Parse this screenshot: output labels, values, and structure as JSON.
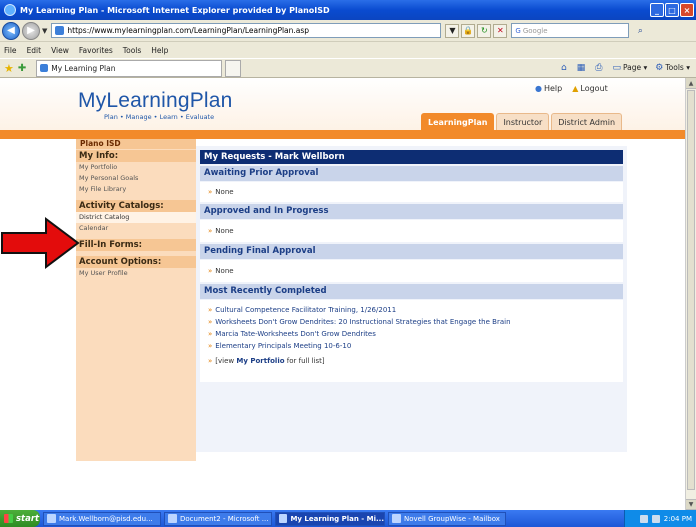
{
  "window": {
    "title": "My Learning Plan - Microsoft Internet Explorer provided by PlanoISD"
  },
  "address": {
    "url": "https://www.mylearningplan.com/LearningPlan/LearningPlan.asp",
    "search_placeholder": "Google"
  },
  "menu": [
    "File",
    "Edit",
    "View",
    "Favorites",
    "Tools",
    "Help"
  ],
  "favbar": {
    "tab_title": "My Learning Plan",
    "page_label": "Page",
    "tools_label": "Tools"
  },
  "site": {
    "logo": "MyLearningPlan",
    "tagline": "Plan • Manage • Learn • Evaluate",
    "help": "Help",
    "logout": "Logout",
    "tabs": [
      {
        "label": "LearningPlan",
        "active": true
      },
      {
        "label": "Instructor",
        "active": false
      },
      {
        "label": "District Admin",
        "active": false
      }
    ],
    "district": "Plano ISD"
  },
  "sidebar": {
    "my_info": {
      "heading": "My Info:",
      "items": [
        "My Portfolio",
        "My Personal Goals",
        "My File Library"
      ]
    },
    "catalogs": {
      "heading": "Activity Catalogs:",
      "items": [
        "District Catalog",
        "Calendar"
      ]
    },
    "forms": {
      "heading": "Fill-In Forms:"
    },
    "account": {
      "heading": "Account Options:",
      "items": [
        "My User Profile"
      ]
    }
  },
  "main": {
    "title": "My Requests - Mark Wellborn",
    "awaiting": {
      "heading": "Awaiting Prior Approval",
      "items": [
        "None"
      ]
    },
    "approved": {
      "heading": "Approved and In Progress",
      "items": [
        "None"
      ]
    },
    "pending": {
      "heading": "Pending Final Approval",
      "items": [
        "None"
      ]
    },
    "completed": {
      "heading": "Most Recently Completed",
      "items": [
        "Cultural Competence Facilitator Training, 1/26/2011",
        "Worksheets Don't Grow Dendrites: 20 Instructional Strategies that Engage the Brain",
        "Marcia Tate-Worksheets Don't Grow Dendrites",
        "Elementary Principals Meeting 10-6-10"
      ],
      "view_prefix": "[view ",
      "view_link": "My Portfolio",
      "view_suffix": " for full list]"
    }
  },
  "taskbar": {
    "start": "start",
    "tasks": [
      "Mark.Wellborn@pisd.edu...",
      "Document2 - Microsoft ...",
      "My Learning Plan - Mi...",
      "Novell GroupWise - Mailbox"
    ],
    "clock": "2:04 PM"
  }
}
